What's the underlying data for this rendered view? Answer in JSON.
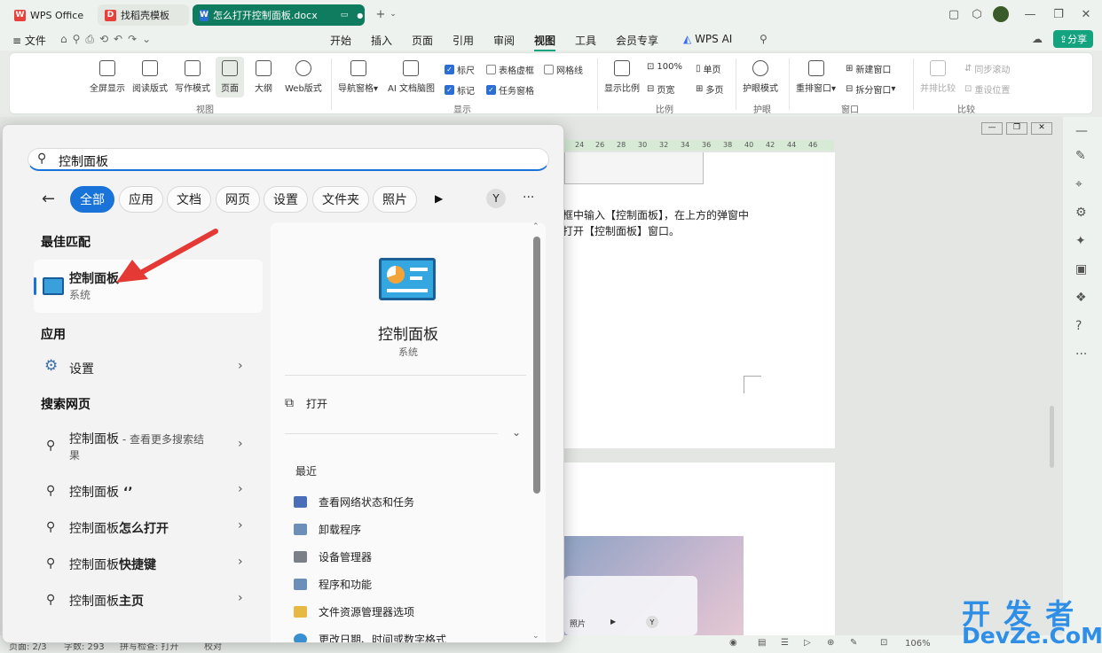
{
  "titlebar": {
    "tabs": [
      {
        "label": "WPS Office",
        "icon": "wps-logo-icon"
      },
      {
        "label": "找稻壳模板",
        "icon": "docer-icon"
      },
      {
        "label": "怎么打开控制面板.docx",
        "icon": "word-doc-icon"
      }
    ],
    "new_tab": "+"
  },
  "menubar": {
    "file": "文件",
    "items": [
      "开始",
      "插入",
      "页面",
      "引用",
      "审阅",
      "视图",
      "工具",
      "会员专享"
    ],
    "active": "视图",
    "wps_ai": "WPS AI",
    "share": "分享"
  },
  "ribbon": {
    "view_buttons": [
      "全屏显示",
      "阅读版式",
      "写作模式",
      "页面",
      "大纲",
      "Web版式"
    ],
    "group_view": "视图",
    "show_buttons": [
      "导航窗格",
      "AI 文档脑图"
    ],
    "checkboxes": [
      {
        "label": "标尺",
        "checked": true
      },
      {
        "label": "表格虚框",
        "checked": false
      },
      {
        "label": "网格线",
        "checked": false
      },
      {
        "label": "标记",
        "checked": true
      },
      {
        "label": "任务窗格",
        "checked": true
      }
    ],
    "group_show": "显示",
    "zoom_button": "显示比例",
    "zoom_100": "100%",
    "single_page": "单页",
    "page_width": "页宽",
    "multi_page": "多页",
    "group_ratio": "比例",
    "eye_mode": "护眼模式",
    "group_eye": "护眼",
    "arrange_window": "重排窗口",
    "new_window": "新建窗口",
    "split_window": "拆分窗口",
    "group_window": "窗口",
    "side_by_side": "并排比较",
    "sync_scroll": "同步滚动",
    "reset_position": "重设位置",
    "group_compare": "比较"
  },
  "document": {
    "ruler_numbers": [
      "24",
      "26",
      "28",
      "30",
      "32",
      "34",
      "36",
      "38",
      "40",
      "42",
      "44",
      "46"
    ],
    "line1": "框中输入【控制面板】，在上方的弹窗中",
    "line2": "打开【控制面板】窗口。",
    "embedded_chip": "照片",
    "embedded_y": "Y"
  },
  "statusbar": {
    "page": "页面: 2/3",
    "words": "字数: 293",
    "spell": "拼写检查: 打开",
    "proof": "校对",
    "zoom": "106%"
  },
  "startmenu": {
    "search_value": "控制面板",
    "filters": [
      "全部",
      "应用",
      "文档",
      "网页",
      "设置",
      "文件夹",
      "照片"
    ],
    "active_filter": "全部",
    "avatar": "Y",
    "more": "···",
    "best_match_heading": "最佳匹配",
    "best_match": {
      "title": "控制面板",
      "subtitle": "系统"
    },
    "apps_heading": "应用",
    "apps": [
      {
        "label": "设置"
      }
    ],
    "web_heading": "搜索网页",
    "web_results": [
      {
        "plain": "控制面板",
        "bold": "",
        "suffix": " - 查看更多搜索结",
        "line2": "果"
      },
      {
        "plain": "控制面板",
        "bold": " ‘’",
        "suffix": "",
        "line2": ""
      },
      {
        "plain": "控制面板",
        "bold": "怎么打开",
        "suffix": "",
        "line2": ""
      },
      {
        "plain": "控制面板",
        "bold": "快捷键",
        "suffix": "",
        "line2": ""
      },
      {
        "plain": "控制面板",
        "bold": "主页",
        "suffix": "",
        "line2": ""
      }
    ],
    "detail": {
      "title": "控制面板",
      "subtitle": "系统",
      "open_label": "打开",
      "recent_heading": "最近",
      "recent": [
        "查看网络状态和任务",
        "卸载程序",
        "设备管理器",
        "程序和功能",
        "文件资源管理器选项",
        "更改日期、时间或数字格式"
      ]
    }
  },
  "watermark": {
    "line1": "开 发 者",
    "line2": "DevZe.CoM"
  },
  "colors": {
    "accent": "#1a73d9",
    "wps_red": "#e8403a",
    "word_blue": "#2b6fd6",
    "active_tab": "#0f7b5f",
    "share_green": "#14a37f",
    "arrow_red": "#e53935"
  }
}
